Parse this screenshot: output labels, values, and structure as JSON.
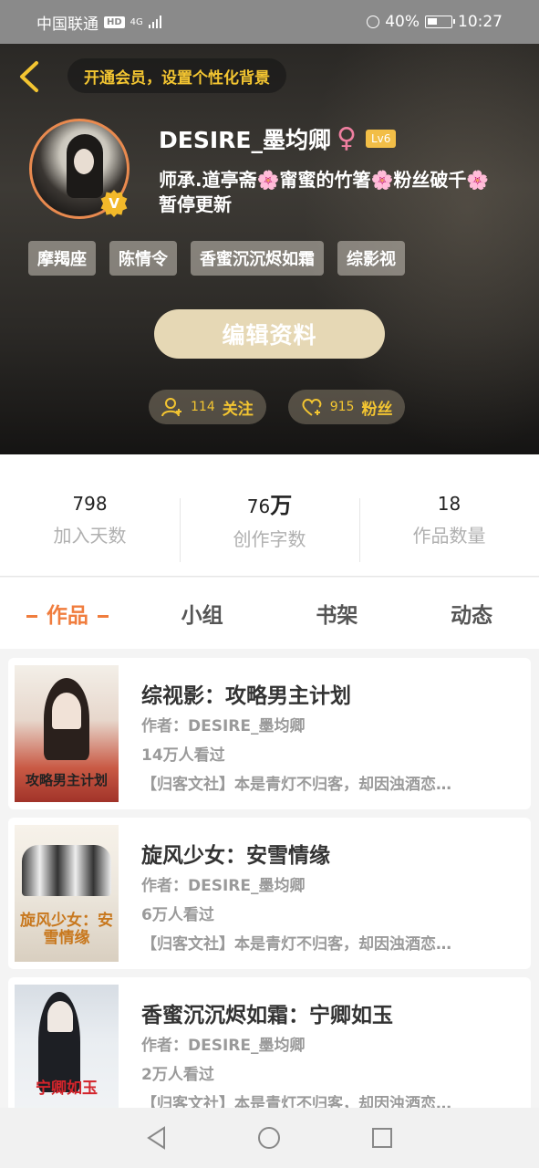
{
  "status_bar": {
    "carrier": "中国联通",
    "network_badge": "HD",
    "network_type": "4G",
    "battery_pct": "40%",
    "time": "10:27"
  },
  "header": {
    "back_icon": "chevron-left-icon",
    "vip_banner": "开通会员，设置个性化背景",
    "username": "DESIRE_墨均卿",
    "gender_icon": "female-icon",
    "level": "Lv6",
    "verified_badge": "V",
    "bio_line1": "师承.道亭斋🌸甯蜜的竹箸🌸粉丝破千🌸",
    "bio_line2": "暂停更新",
    "tags": [
      "摩羯座",
      "陈情令",
      "香蜜沉沉烬如霜",
      "综影视"
    ],
    "edit_button": "编辑资料",
    "following_count": "114",
    "following_label": "关注",
    "followers_count": "915",
    "followers_label": "粉丝"
  },
  "stats": [
    {
      "value": "798",
      "unit": "",
      "label": "加入天数"
    },
    {
      "value": "76",
      "unit": "万",
      "label": "创作字数"
    },
    {
      "value": "18",
      "unit": "",
      "label": "作品数量"
    }
  ],
  "tabs": [
    {
      "label": "作品",
      "active": true
    },
    {
      "label": "小组",
      "active": false
    },
    {
      "label": "书架",
      "active": false
    },
    {
      "label": "动态",
      "active": false
    }
  ],
  "books": [
    {
      "title": "综视影：攻略男主计划",
      "author": "作者：DESIRE_墨均卿",
      "views": "14万人看过",
      "desc": "【归客文社】本是青灯不归客，却因浊酒恋…",
      "cover_text": "攻略男主计划"
    },
    {
      "title": "旋风少女：安雪情缘",
      "author": "作者：DESIRE_墨均卿",
      "views": "6万人看过",
      "desc": "【归客文社】本是青灯不归客，却因浊酒恋…",
      "cover_text": "旋风少女：安雪情缘"
    },
    {
      "title": "香蜜沉沉烬如霜：宁卿如玉",
      "author": "作者：DESIRE_墨均卿",
      "views": "2万人看过",
      "desc": "【归客文社】本是青灯不归客，却因浊酒恋…",
      "cover_text": "宁卿如玉"
    }
  ],
  "colors": {
    "accent": "#f07d3e",
    "gold": "#f3c531",
    "edit_button": "#e6d8b5"
  }
}
